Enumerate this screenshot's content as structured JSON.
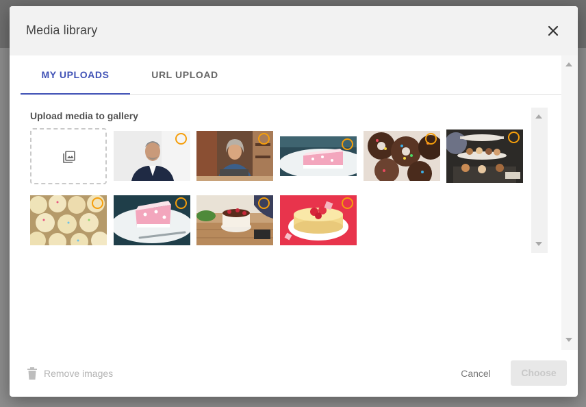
{
  "dialog": {
    "title": "Media library"
  },
  "tabs": [
    {
      "label": "MY UPLOADS",
      "active": true
    },
    {
      "label": "URL UPLOAD",
      "active": false
    }
  ],
  "gallery": {
    "label": "Upload media to gallery",
    "upload_icon": "add-photos-icon",
    "images": [
      {
        "name": "businessman-portrait"
      },
      {
        "name": "woman-at-laptop"
      },
      {
        "name": "pink-cake-slice"
      },
      {
        "name": "sprinkle-donuts"
      },
      {
        "name": "dessert-table"
      },
      {
        "name": "cupcakes"
      },
      {
        "name": "pink-cake-slice-fork"
      },
      {
        "name": "decorating-cake"
      },
      {
        "name": "strawberry-cheesecake"
      }
    ]
  },
  "footer": {
    "remove_label": "Remove images",
    "cancel_label": "Cancel",
    "choose_label": "Choose"
  },
  "colors": {
    "accent": "#3f51b5",
    "select_ring": "#f59e0b"
  }
}
